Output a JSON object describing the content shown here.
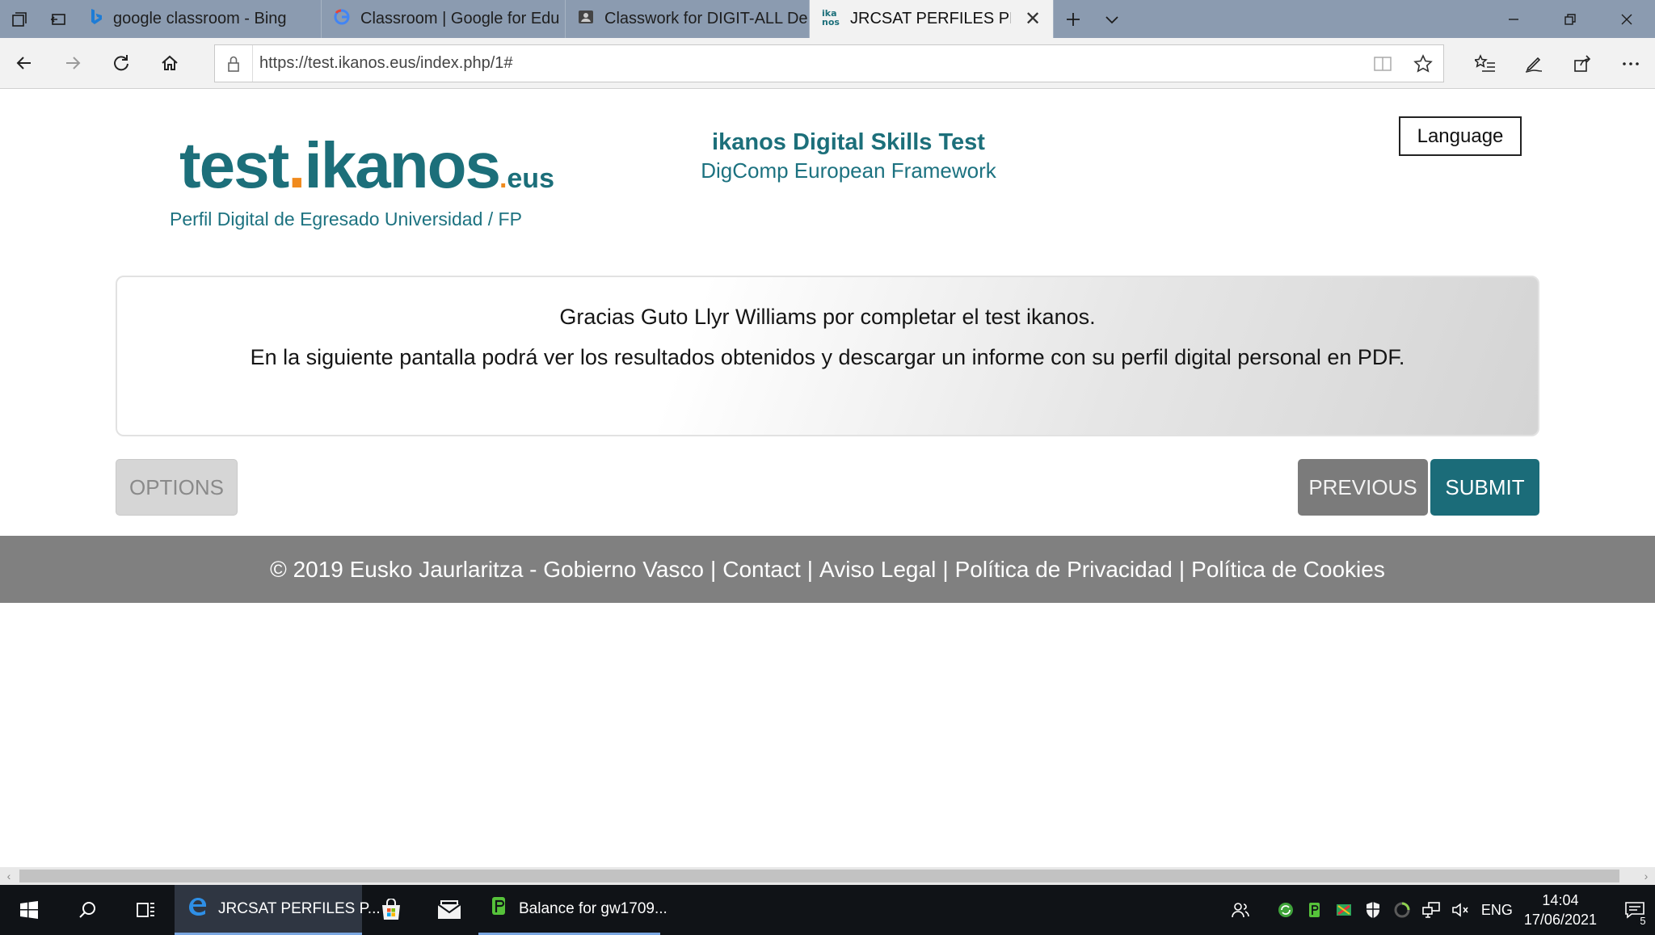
{
  "browser": {
    "tabs": [
      {
        "title": "google classroom - Bing",
        "icon": "bing-icon"
      },
      {
        "title": "Classroom | Google for Edu",
        "icon": "google-icon"
      },
      {
        "title": "Classwork for DIGIT-ALL De",
        "icon": "classroom-icon"
      },
      {
        "title": "JRCSAT PERFILES PROFE",
        "icon": "ikanos-icon",
        "active": true
      }
    ],
    "address": "https://test.ikanos.eus/index.php/1#"
  },
  "page": {
    "logo": {
      "main": "test",
      "dot": ".",
      "mid": "ikanos",
      "dot2": ".",
      "suffix": "eus"
    },
    "logo_subtitle": "Perfil Digital de Egresado Universidad / FP",
    "header_title": "ikanos Digital Skills Test",
    "header_subtitle": "DigComp European Framework",
    "language_button": "Language",
    "message_line1": "Gracias Guto Llyr Williams por completar el test ikanos.",
    "message_line2": "En la siguiente pantalla podrá ver los resultados obtenidos y descargar un informe con su perfil digital personal en PDF.",
    "options_button": "OPTIONS",
    "previous_button": "PREVIOUS",
    "submit_button": "SUBMIT",
    "footer": {
      "copyright": "© 2019 Eusko Jaurlaritza - Gobierno Vasco",
      "separator": "|",
      "contact": "Contact",
      "legal": "Aviso Legal",
      "privacy": "Política de Privacidad",
      "cookies": "Política de Cookies"
    },
    "colors": {
      "brand_teal": "#1b6c79",
      "brand_orange": "#f08a1d",
      "footer_gray": "#808080"
    }
  },
  "taskbar": {
    "apps": [
      {
        "label": "JRCSAT PERFILES P...",
        "icon": "edge-icon",
        "active": true
      },
      {
        "label": "Balance for gw1709...",
        "icon": "green-app-icon",
        "open": true
      }
    ],
    "language": "ENG",
    "time": "14:04",
    "date": "17/06/2021",
    "notification_count": "5"
  }
}
